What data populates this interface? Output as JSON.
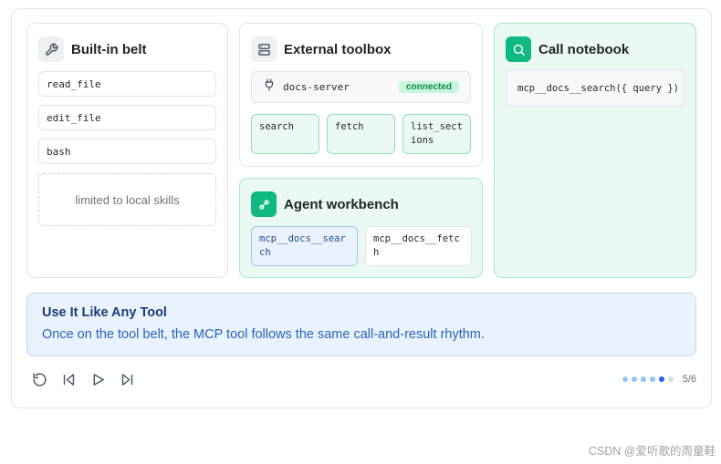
{
  "builtin": {
    "title": "Built-in belt",
    "tools": [
      "read_file",
      "edit_file",
      "bash"
    ],
    "note": "limited to local skills"
  },
  "external": {
    "title": "External toolbox",
    "server": "docs-server",
    "status": "connected",
    "tools": [
      "search",
      "fetch",
      "list_sections"
    ]
  },
  "workbench": {
    "title": "Agent workbench",
    "tools": [
      "mcp__docs__search",
      "mcp__docs__fetch"
    ]
  },
  "notebook": {
    "title": "Call notebook",
    "call": "mcp__docs__search({ query })"
  },
  "info": {
    "title": "Use It Like Any Tool",
    "body": "Once on the tool belt, the MCP tool follows the same call-and-result rhythm."
  },
  "progress": {
    "label": "5/6",
    "current": 5,
    "total": 6
  },
  "watermark": "CSDN @爱听歌的周童鞋",
  "icons": {
    "builtin": "wrench-icon",
    "external": "server-icon",
    "server": "plug-icon",
    "workbench": "plug-connect-icon",
    "notebook": "search-icon",
    "controls": [
      "replay-icon",
      "skip-back-icon",
      "play-icon",
      "skip-forward-icon"
    ]
  },
  "colors": {
    "accent_green": "#10b981",
    "green_bg": "#eafaf2",
    "info_bg": "#eaf3fd",
    "info_title": "#1a3c78",
    "active_dot": "#2563eb"
  }
}
